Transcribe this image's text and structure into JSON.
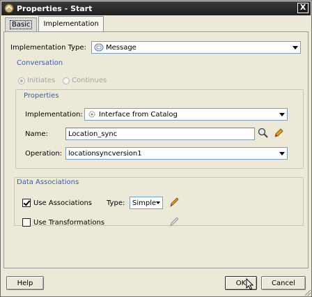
{
  "window": {
    "title": "Properties - Start",
    "close_glyph": "X"
  },
  "tabs": [
    {
      "label": "Basic",
      "active": true
    },
    {
      "label": "Implementation",
      "active": false
    }
  ],
  "implementation_type": {
    "label": "Implementation Type:",
    "value": "Message",
    "icon": "message-icon"
  },
  "conversation": {
    "label": "Conversation",
    "initiates": "Initiates",
    "continues": "Continues",
    "selected": "Initiates"
  },
  "properties": {
    "label": "Properties",
    "implementation_label": "Implementation:",
    "implementation_value": "Interface from Catalog",
    "implementation_icon": "catalog-gear-icon",
    "name_label": "Name:",
    "name_value": "Location_sync",
    "operation_label": "Operation:",
    "operation_value": "locationsyncversion1"
  },
  "data_associations": {
    "label": "Data Associations",
    "use_associations_label": "Use Associations",
    "use_associations_checked": true,
    "type_label": "Type:",
    "type_value": "Simple",
    "use_transformations_label": "Use Transformations",
    "use_transformations_checked": false
  },
  "footer": {
    "help_label": "Help",
    "ok_label": "OK",
    "cancel_label": "Cancel"
  },
  "colors": {
    "title_bar": "#1f1f1f",
    "section_label": "#3b5ea8",
    "window_bg": "#ece9d8"
  }
}
